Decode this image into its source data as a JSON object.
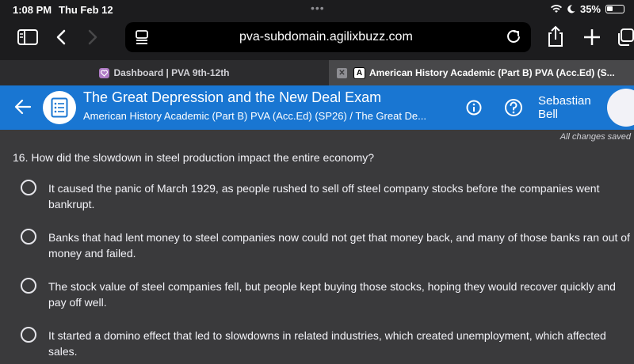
{
  "status": {
    "time": "1:08 PM",
    "date": "Thu Feb 12",
    "battery": "35%"
  },
  "browser": {
    "url": "pva-subdomain.agilixbuzz.com",
    "tabs": [
      {
        "label": "Dashboard | PVA 9th-12th",
        "favicon": "heart-icon",
        "active": false
      },
      {
        "label": "American History Academic (Part B) PVA (Acc.Ed) (S...",
        "favicon": "letter-a-icon",
        "favicon_text": "A",
        "active": true
      }
    ]
  },
  "header": {
    "title": "The Great Depression and the New Deal Exam",
    "subtitle": "American History Academic (Part B) PVA (Acc.Ed) (SP26) / The Great De...",
    "user_first": "Sebastian",
    "user_last": "Bell",
    "color": "#1976d2"
  },
  "saved_status": "All changes saved",
  "question": {
    "text": "16. How did the slowdown in steel production impact the entire economy?",
    "options": [
      {
        "text": "It caused the panic of March 1929, as people rushed to sell off steel company stocks before the companies went bankrupt."
      },
      {
        "text": "Banks that had lent money to steel companies now could not get that money back, and many of those banks ran out of money and failed."
      },
      {
        "text": "The stock value of steel companies fell, but people kept buying those stocks, hoping they would recover quickly and pay off well."
      },
      {
        "text": "It started a domino effect that led to slowdowns in related industries, which created unemployment, which affected sales."
      }
    ]
  }
}
